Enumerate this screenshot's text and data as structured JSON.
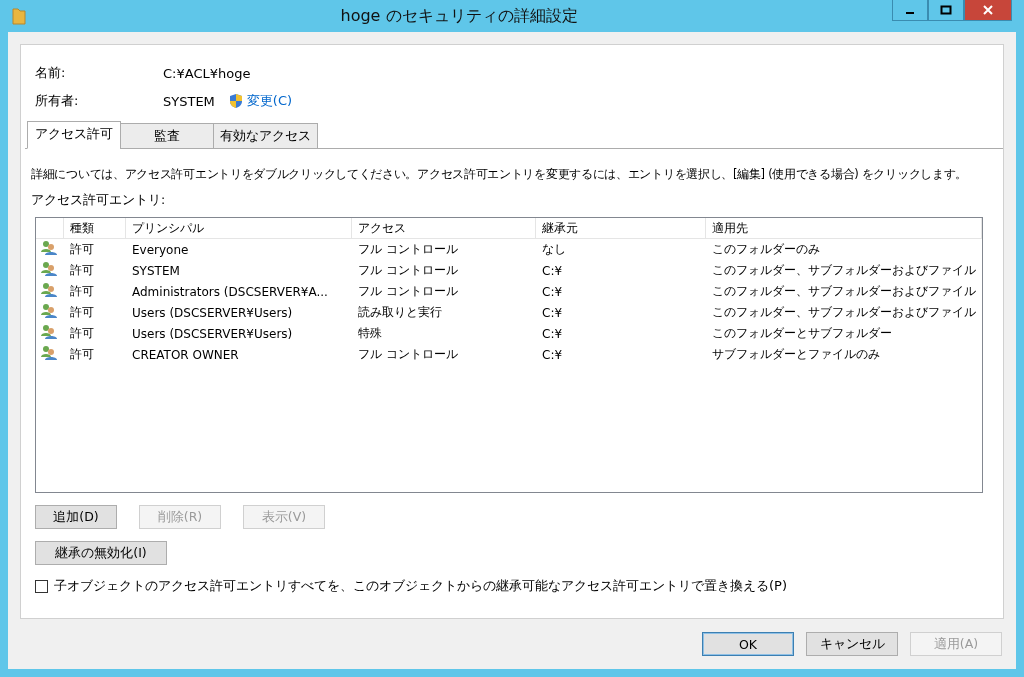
{
  "window": {
    "title": "hoge のセキュリティの詳細設定"
  },
  "name_field": {
    "label": "名前:",
    "value": "C:¥ACL¥hoge"
  },
  "owner_field": {
    "label": "所有者:",
    "value": "SYSTEM",
    "change_link": "変更(C)"
  },
  "tabs": [
    {
      "label": "アクセス許可",
      "selected": true
    },
    {
      "label": "監査",
      "selected": false
    },
    {
      "label": "有効なアクセス",
      "selected": false
    }
  ],
  "description": "詳細については、アクセス許可エントリをダブルクリックしてください。アクセス許可エントリを変更するには、エントリを選択し、[編集] (使用できる場合) をクリックします。",
  "list_label": "アクセス許可エントリ:",
  "table": {
    "columns": [
      "種類",
      "プリンシパル",
      "アクセス",
      "継承元",
      "適用先"
    ],
    "rows": [
      {
        "cells": [
          "許可",
          "Everyone",
          "フル コントロール",
          "なし",
          "このフォルダーのみ"
        ],
        "selected": false
      },
      {
        "cells": [
          "許可",
          "SYSTEM",
          "フル コントロール",
          "C:¥",
          "このフォルダー、サブフォルダーおよびファイル"
        ],
        "selected": false
      },
      {
        "cells": [
          "許可",
          "Administrators (DSCSERVER¥A...",
          "フル コントロール",
          "C:¥",
          "このフォルダー、サブフォルダーおよびファイル"
        ],
        "selected": false
      },
      {
        "cells": [
          "許可",
          "Users (DSCSERVER¥Users)",
          "読み取りと実行",
          "C:¥",
          "このフォルダー、サブフォルダーおよびファイル"
        ],
        "selected": false
      },
      {
        "cells": [
          "許可",
          "Users (DSCSERVER¥Users)",
          "特殊",
          "C:¥",
          "このフォルダーとサブフォルダー"
        ],
        "selected": false
      },
      {
        "cells": [
          "許可",
          "CREATOR OWNER",
          "フル コントロール",
          "C:¥",
          "サブフォルダーとファイルのみ"
        ],
        "selected": false
      }
    ]
  },
  "entry_buttons": [
    {
      "label": "追加(D)",
      "disabled": false
    },
    {
      "label": "削除(R)",
      "disabled": true
    },
    {
      "label": "表示(V)",
      "disabled": true
    }
  ],
  "inheritance_button": {
    "label": "継承の無効化(I)",
    "disabled": false
  },
  "replace_checkbox": {
    "label": "子オブジェクトのアクセス許可エントリすべてを、このオブジェクトからの継承可能なアクセス許可エントリで置き換える(P)",
    "checked": false
  },
  "dialog_buttons": [
    {
      "label": "OK",
      "disabled": false,
      "default": true
    },
    {
      "label": "キャンセル",
      "disabled": false,
      "default": false
    },
    {
      "label": "適用(A)",
      "disabled": true,
      "default": false
    }
  ]
}
